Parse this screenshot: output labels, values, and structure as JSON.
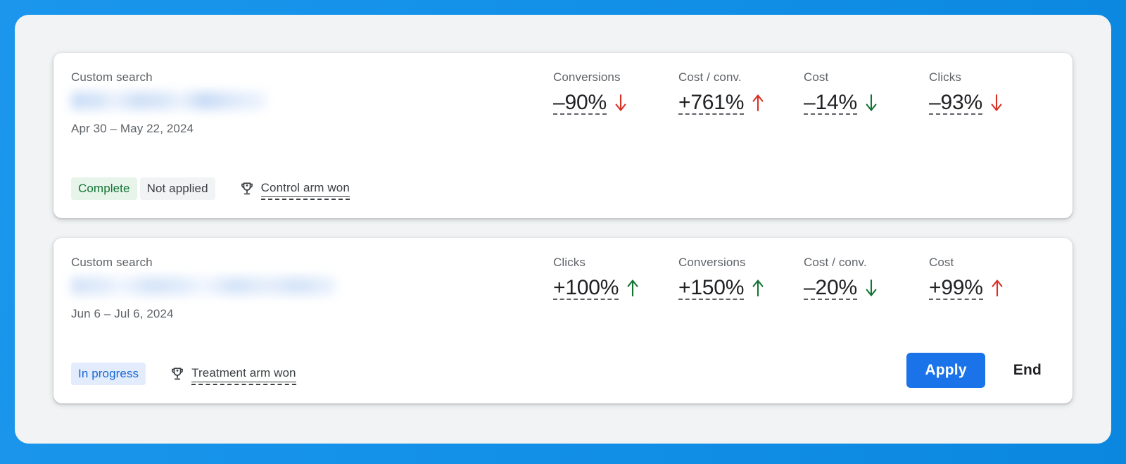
{
  "theme": {
    "background_blue": "#1390e8",
    "panel_bg": "#f1f3f4",
    "card_bg": "#ffffff",
    "accent_blue": "#1a73e8",
    "positive_green": "#137333",
    "negative_red": "#d93025",
    "text_primary": "#202124",
    "text_secondary": "#5f6368"
  },
  "experiments": [
    {
      "type_label": "Custom search",
      "name_redacted": true,
      "date_range": "Apr 30 – May 22, 2024",
      "status_chips": [
        {
          "label": "Complete",
          "style": "complete"
        },
        {
          "label": "Not applied",
          "style": "not-applied"
        }
      ],
      "winner": {
        "icon": "trophy-icon",
        "label": "Control arm won"
      },
      "metrics": [
        {
          "label": "Conversions",
          "value": "–90%",
          "direction": "down",
          "color": "#d93025",
          "arrow": "arrow-down-icon"
        },
        {
          "label": "Cost / conv.",
          "value": "+761%",
          "direction": "up",
          "color": "#d93025",
          "arrow": "arrow-up-icon"
        },
        {
          "label": "Cost",
          "value": "–14%",
          "direction": "down",
          "color": "#137333",
          "arrow": "arrow-down-icon"
        },
        {
          "label": "Clicks",
          "value": "–93%",
          "direction": "down",
          "color": "#d93025",
          "arrow": "arrow-down-icon"
        }
      ],
      "actions": []
    },
    {
      "type_label": "Custom search",
      "name_redacted": true,
      "date_range": "Jun 6 – Jul 6, 2024",
      "status_chips": [
        {
          "label": "In progress",
          "style": "in-progress"
        }
      ],
      "winner": {
        "icon": "trophy-icon",
        "label": "Treatment arm won"
      },
      "metrics": [
        {
          "label": "Clicks",
          "value": "+100%",
          "direction": "up",
          "color": "#137333",
          "arrow": "arrow-up-icon"
        },
        {
          "label": "Conversions",
          "value": "+150%",
          "direction": "up",
          "color": "#137333",
          "arrow": "arrow-up-icon"
        },
        {
          "label": "Cost / conv.",
          "value": "–20%",
          "direction": "down",
          "color": "#137333",
          "arrow": "arrow-down-icon"
        },
        {
          "label": "Cost",
          "value": "+99%",
          "direction": "up",
          "color": "#d93025",
          "arrow": "arrow-up-icon"
        }
      ],
      "actions": [
        {
          "label": "Apply",
          "style": "primary"
        },
        {
          "label": "End",
          "style": "text"
        }
      ]
    }
  ]
}
